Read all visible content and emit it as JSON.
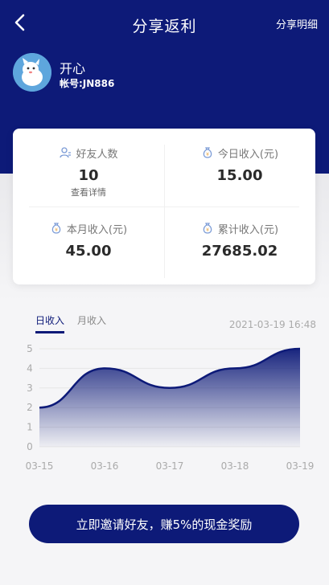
{
  "header": {
    "title": "分享返利",
    "detail_link": "分享明细"
  },
  "user": {
    "name": "开心",
    "account": "帐号:JN886"
  },
  "stats": {
    "friends": {
      "icon": "users-icon",
      "label": "好友人数",
      "value": "10",
      "link": "查看详情"
    },
    "today": {
      "icon": "money-bag-icon",
      "label": "今日收入(元)",
      "value": "15.00"
    },
    "month": {
      "icon": "money-bag-icon",
      "label": "本月收入(元)",
      "value": "45.00"
    },
    "total": {
      "icon": "money-bag-icon",
      "label": "累计收入(元)",
      "value": "27685.02"
    }
  },
  "tabs": [
    {
      "label": "日收入",
      "active": true
    },
    {
      "label": "月收入",
      "active": false
    }
  ],
  "timestamp": "2021-03-19 16:48",
  "invite_button": "立即邀请好友，赚5%的现金奖励",
  "colors": {
    "primary": "#0d1a78",
    "line": "#0d1a78"
  },
  "chart_data": {
    "type": "area",
    "categories": [
      "03-15",
      "03-16",
      "03-17",
      "03-18",
      "03-19"
    ],
    "x": [
      "03-15",
      "03-16",
      "03-17",
      "03-18",
      "03-19"
    ],
    "values": [
      2,
      4,
      3,
      4,
      5
    ],
    "y_ticks": [
      0,
      1,
      2,
      3,
      4,
      5
    ],
    "ylim": [
      0,
      5
    ],
    "grid": true,
    "title": "",
    "xlabel": "",
    "ylabel": ""
  }
}
